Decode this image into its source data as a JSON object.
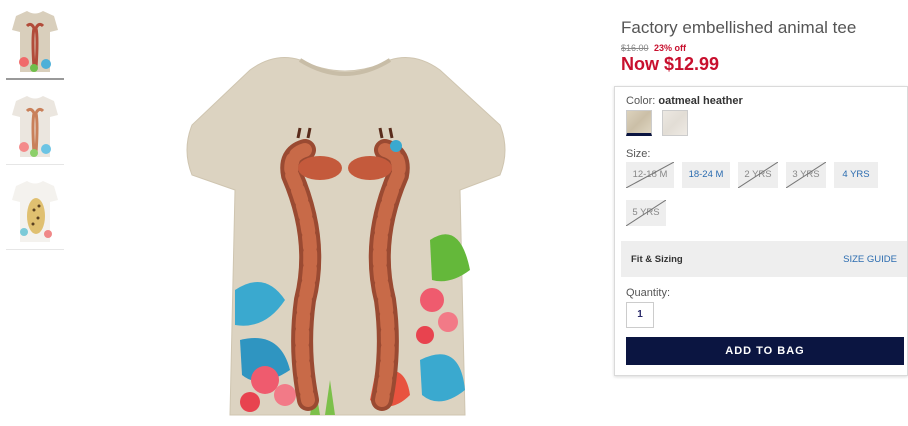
{
  "product": {
    "title": "Factory embellished animal tee",
    "original_price": "$16.00",
    "discount": "23% off",
    "now_price": "Now $12.99"
  },
  "thumbnails": [
    {
      "name": "giraffe-tee-oatmeal",
      "selected": true
    },
    {
      "name": "giraffe-tee-light",
      "selected": false
    },
    {
      "name": "leopard-tee-white",
      "selected": false
    }
  ],
  "color": {
    "label": "Color:",
    "selected": "oatmeal heather",
    "swatches": [
      "oatmeal heather",
      "light heather"
    ]
  },
  "size": {
    "label": "Size:",
    "options": [
      {
        "label": "12-18 M",
        "available": false
      },
      {
        "label": "18-24 M",
        "available": true
      },
      {
        "label": "2 YRS",
        "available": false
      },
      {
        "label": "3 YRS",
        "available": false
      },
      {
        "label": "4 YRS",
        "available": true
      },
      {
        "label": "5 YRS",
        "available": false
      }
    ]
  },
  "fit": {
    "label": "Fit & Sizing",
    "guide_link": "SIZE GUIDE"
  },
  "quantity": {
    "label": "Quantity:",
    "value": "1"
  },
  "cta": {
    "add_to_bag": "ADD TO BAG"
  },
  "colors": {
    "sale_red": "#c8102e",
    "navy": "#0b1541",
    "link_blue": "#2b6cb0"
  }
}
